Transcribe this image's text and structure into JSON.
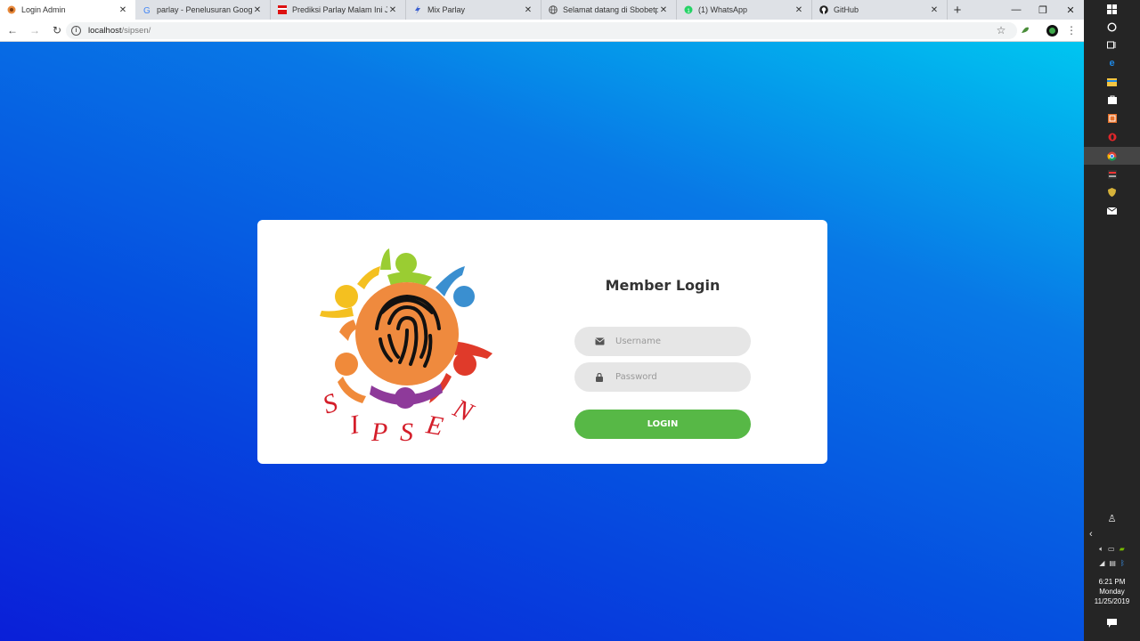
{
  "browser": {
    "tabs": [
      {
        "title": "Login Admin",
        "active": true,
        "favicon": "login-favicon"
      },
      {
        "title": "parlay - Penelusuran Google",
        "active": false,
        "favicon": "google-favicon"
      },
      {
        "title": "Prediksi Parlay Malam Ini Jitu -",
        "active": false,
        "favicon": "prediksi-favicon"
      },
      {
        "title": "Mix Parlay",
        "active": false,
        "favicon": "mixparlay-favicon"
      },
      {
        "title": "Selamat datang di Sbobetparla",
        "active": false,
        "favicon": "globe-icon"
      },
      {
        "title": "(1) WhatsApp",
        "active": false,
        "favicon": "whatsapp-icon"
      },
      {
        "title": "GitHub",
        "active": false,
        "favicon": "github-icon"
      }
    ],
    "url_host": "localhost",
    "url_path": "/sipsen/"
  },
  "login": {
    "title": "Member Login",
    "username_placeholder": "Username",
    "password_placeholder": "Password",
    "button_label": "LOGIN",
    "logo_text": "SIPSEN",
    "accent_color": "#57b846"
  },
  "taskbar": {
    "time": "6:21 PM",
    "day": "Monday",
    "date": "11/25/2019"
  }
}
